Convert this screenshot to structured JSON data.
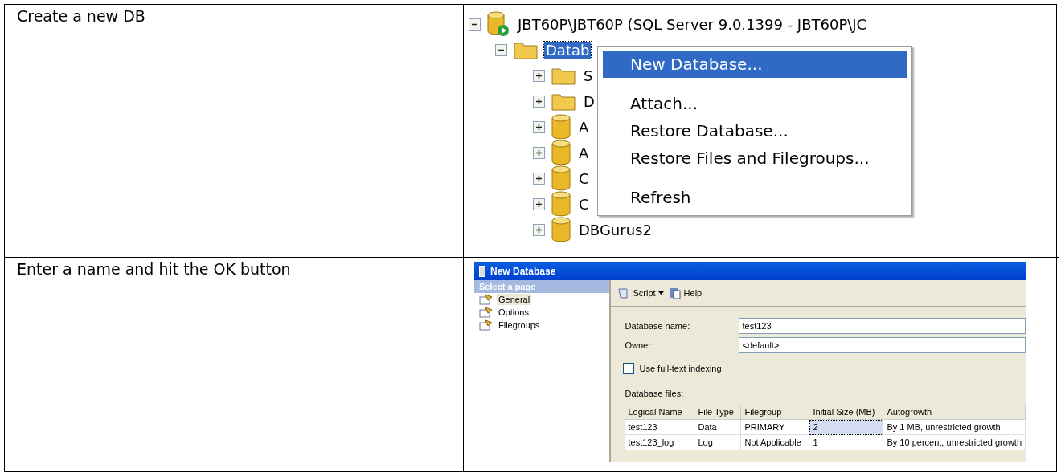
{
  "rows": [
    {
      "caption": "Create a new DB",
      "screenshot": {
        "kind": "tree",
        "server": {
          "label": "JBT60P\\JBT60P (SQL Server 9.0.1399 - JBT60P\\JC",
          "expanded": true
        },
        "folder": {
          "label": "Datab",
          "expanded": true,
          "selected": true
        },
        "children": [
          {
            "kind": "folder",
            "label": "S"
          },
          {
            "kind": "folder",
            "label": "D"
          },
          {
            "kind": "database",
            "label": "A"
          },
          {
            "kind": "database",
            "label": "A"
          },
          {
            "kind": "database",
            "label": "C"
          },
          {
            "kind": "database",
            "label": "C"
          },
          {
            "kind": "database",
            "label": "DBGurus2"
          }
        ],
        "menu": [
          {
            "kind": "item",
            "label": "New Database...",
            "selected": true
          },
          {
            "kind": "separator"
          },
          {
            "kind": "item",
            "label": "Attach...",
            "selected": false
          },
          {
            "kind": "item",
            "label": "Restore Database...",
            "selected": false
          },
          {
            "kind": "item",
            "label": "Restore Files and Filegroups...",
            "selected": false
          },
          {
            "kind": "separator"
          },
          {
            "kind": "item",
            "label": "Refresh",
            "selected": false
          }
        ]
      }
    },
    {
      "caption": "Enter a name and hit the OK button",
      "screenshot": {
        "kind": "dialog",
        "title": "New Database",
        "pages_header": "Select a page",
        "pages": [
          {
            "label": "General",
            "selected": true
          },
          {
            "label": "Options",
            "selected": false
          },
          {
            "label": "Filegroups",
            "selected": false
          }
        ],
        "toolbar": [
          "Script",
          "Help"
        ],
        "fields": [
          {
            "label": "Database name:",
            "value": "test123"
          },
          {
            "label": "Owner:",
            "value": "<default>"
          }
        ],
        "fulltext": {
          "label": "Use full-text indexing",
          "checked": false
        },
        "files_label": "Database files:",
        "columns": [
          "Logical Name",
          "File Type",
          "Filegroup",
          "Initial Size (MB)",
          "Autogrowth"
        ],
        "files": [
          {
            "cells": [
              {
                "text": "test123",
                "selected": false
              },
              {
                "text": "Data",
                "selected": false
              },
              {
                "text": "PRIMARY",
                "selected": false
              },
              {
                "text": "2",
                "selected": true
              },
              {
                "text": "By 1 MB, unrestricted growth",
                "selected": false
              }
            ]
          },
          {
            "cells": [
              {
                "text": "test123_log",
                "selected": false
              },
              {
                "text": "Log",
                "selected": false
              },
              {
                "text": "Not Applicable",
                "selected": false
              },
              {
                "text": "1",
                "selected": false
              },
              {
                "text": "By 10 percent, unrestricted growth",
                "selected": false
              }
            ]
          }
        ]
      }
    }
  ]
}
